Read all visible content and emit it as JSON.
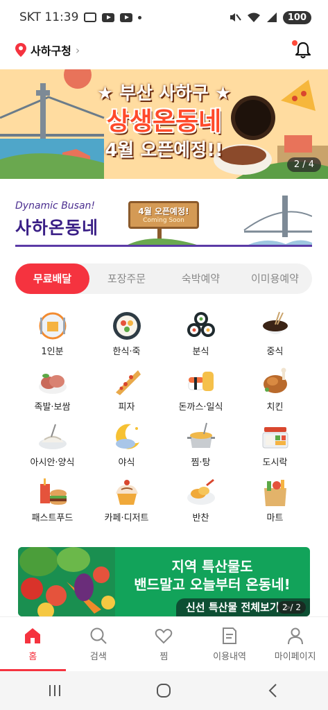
{
  "status_bar": {
    "carrier_time": "SKT 11:39",
    "battery": "100"
  },
  "header": {
    "location": "사하구청"
  },
  "hero_banner": {
    "line1": "★ 부산 사하구 ★",
    "line2": "상생온동네",
    "line3": "4월 오픈예정!!",
    "counter": "2 / 4"
  },
  "busan_banner": {
    "subtitle": "Dynamic Busan!",
    "title": "사하온동네",
    "sign_main": "4월 오픈예정!",
    "sign_sub": "Coming Soon"
  },
  "order_tabs": [
    {
      "label": "무료배달",
      "active": true
    },
    {
      "label": "포장주문",
      "active": false
    },
    {
      "label": "숙박예약",
      "active": false
    },
    {
      "label": "이미용예약",
      "active": false
    }
  ],
  "categories": [
    {
      "label": "1인분",
      "icon": "single-meal-icon"
    },
    {
      "label": "한식·죽",
      "icon": "korean-food-icon"
    },
    {
      "label": "분식",
      "icon": "snack-food-icon"
    },
    {
      "label": "중식",
      "icon": "chinese-food-icon"
    },
    {
      "label": "족발·보쌈",
      "icon": "pork-hock-icon"
    },
    {
      "label": "피자",
      "icon": "pizza-icon"
    },
    {
      "label": "돈까스·일식",
      "icon": "japanese-food-icon"
    },
    {
      "label": "치킨",
      "icon": "chicken-icon"
    },
    {
      "label": "아시안·양식",
      "icon": "asian-western-icon"
    },
    {
      "label": "야식",
      "icon": "late-night-icon"
    },
    {
      "label": "찜·탕",
      "icon": "stew-icon"
    },
    {
      "label": "도시락",
      "icon": "lunchbox-icon"
    },
    {
      "label": "패스트푸드",
      "icon": "fast-food-icon"
    },
    {
      "label": "카페·디저트",
      "icon": "cafe-dessert-icon"
    },
    {
      "label": "반찬",
      "icon": "side-dish-icon"
    },
    {
      "label": "마트",
      "icon": "mart-icon"
    }
  ],
  "produce_banner": {
    "line1": "지역 특산물도",
    "line2": "밴드말고 오늘부터 온동네!",
    "pill": "신선 특산물 전체보기 >",
    "counter": "2 / 2"
  },
  "bottom_nav": [
    {
      "label": "홈",
      "icon": "home-icon",
      "active": true
    },
    {
      "label": "검색",
      "icon": "search-icon",
      "active": false
    },
    {
      "label": "찜",
      "icon": "heart-icon",
      "active": false
    },
    {
      "label": "이용내역",
      "icon": "receipt-icon",
      "active": false
    },
    {
      "label": "마이페이지",
      "icon": "person-icon",
      "active": false
    }
  ],
  "colors": {
    "accent": "#f5333f",
    "busan_purple": "#3a1f86",
    "produce_green": "#12a35a"
  }
}
